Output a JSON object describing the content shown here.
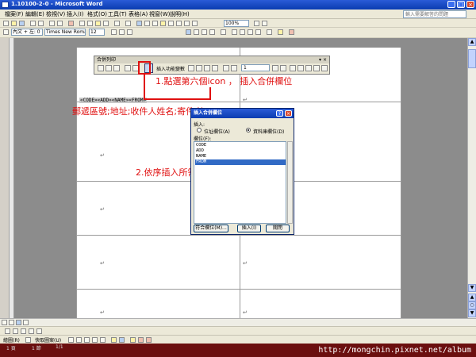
{
  "window": {
    "title": "1.10100-2-0 - Microsoft Word",
    "caption_buttons": [
      "_",
      "□",
      "×"
    ]
  },
  "menu": {
    "items": [
      "檔案(F)",
      "編輯(E)",
      "檢視(V)",
      "插入(I)",
      "格式(O)",
      "工具(T)",
      "表格(A)",
      "視窗(W)",
      "說明(H)"
    ],
    "help_placeholder": "輸入需要解答的問題"
  },
  "standard_toolbar": {
    "zoom": "100%"
  },
  "format_toolbar": {
    "style": "內文 + 左: 0",
    "font": "Times New Roman",
    "size": "12"
  },
  "mail_merge_toolbar": {
    "title": "合併列印",
    "insert_word_field": "插入功能變數",
    "record": "1"
  },
  "document": {
    "merged_fields": "«CODE»«ADD»«NAME»«FROM»"
  },
  "annotations": {
    "step1": "1.點選第六個icon ， 插入合併欄位",
    "fields_note": "郵遞區號;地址;收件人姓名;寄件者",
    "step2": "2.依序插入所需要的資料"
  },
  "dialog": {
    "title": "插入合併欄位",
    "insert_label": "插入:",
    "radio_address": "位址欄位(A)",
    "radio_database": "資料庫欄位(D)",
    "selected_radio": "radio_database",
    "fields_label": "欄位(F):",
    "fields": [
      "CODE",
      "ADD",
      "NAME",
      "FROM"
    ],
    "selected_field": "FROM",
    "match_button": "符合欄位(M)...",
    "insert_button": "插入(I)",
    "close_button": "關閉"
  },
  "drawing_toolbar": {
    "draw": "繪圖(R)",
    "autoshapes": "快取圖案(U)"
  },
  "status": {
    "page": "1 頁",
    "section": "1 節",
    "pages": "1/1"
  },
  "watermark": "http://mongchin.pixnet.net/album",
  "colors": {
    "accent": "#e01010",
    "titlebar": "#0a3cb0",
    "selection": "#316ac5"
  }
}
